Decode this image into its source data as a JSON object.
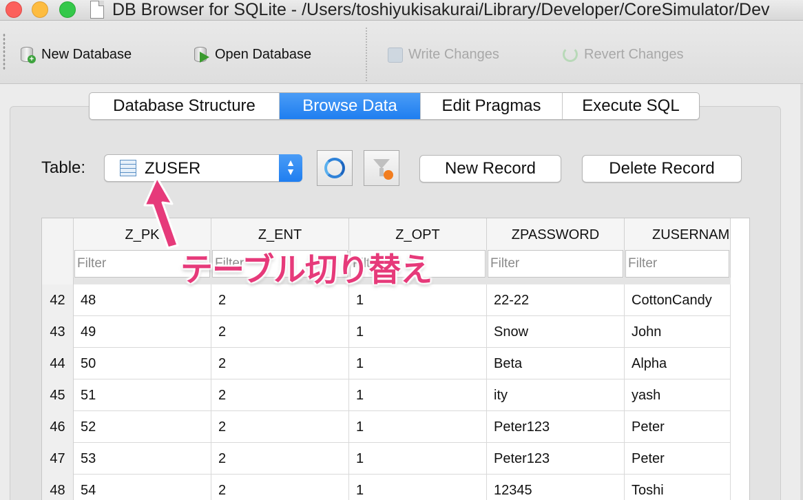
{
  "window": {
    "title": "DB Browser for SQLite - /Users/toshiyukisakurai/Library/Developer/CoreSimulator/Dev"
  },
  "toolbar": {
    "new_database": "New Database",
    "open_database": "Open Database",
    "write_changes": "Write Changes",
    "revert_changes": "Revert Changes"
  },
  "tabs": [
    {
      "label": "Database Structure",
      "active": false
    },
    {
      "label": "Browse Data",
      "active": true
    },
    {
      "label": "Edit Pragmas",
      "active": false
    },
    {
      "label": "Execute SQL",
      "active": false
    }
  ],
  "browse": {
    "table_label": "Table:",
    "table_selected": "ZUSER",
    "new_record": "New Record",
    "delete_record": "Delete Record"
  },
  "grid": {
    "columns": [
      "Z_PK",
      "Z_ENT",
      "Z_OPT",
      "ZPASSWORD",
      "ZUSERNAME"
    ],
    "filter_placeholder": "Filter",
    "rows": [
      {
        "num": "42",
        "cells": [
          "48",
          "2",
          "1",
          "22-22",
          "CottonCandy"
        ]
      },
      {
        "num": "43",
        "cells": [
          "49",
          "2",
          "1",
          "Snow",
          "John"
        ]
      },
      {
        "num": "44",
        "cells": [
          "50",
          "2",
          "1",
          "Beta",
          "Alpha"
        ]
      },
      {
        "num": "45",
        "cells": [
          "51",
          "2",
          "1",
          "ity",
          "yash"
        ]
      },
      {
        "num": "46",
        "cells": [
          "52",
          "2",
          "1",
          "Peter123",
          "Peter"
        ]
      },
      {
        "num": "47",
        "cells": [
          "53",
          "2",
          "1",
          "Peter123",
          "Peter"
        ]
      },
      {
        "num": "48",
        "cells": [
          "54",
          "2",
          "1",
          "12345",
          "Toshi"
        ]
      }
    ]
  },
  "annotation": {
    "text": "テーブル切り替え",
    "color": "#e63a7a"
  },
  "colors": {
    "accent": "#1f7ef0",
    "traffic_close": "#fc605c",
    "traffic_minimize": "#fdbc40",
    "traffic_zoom": "#34c84a"
  }
}
